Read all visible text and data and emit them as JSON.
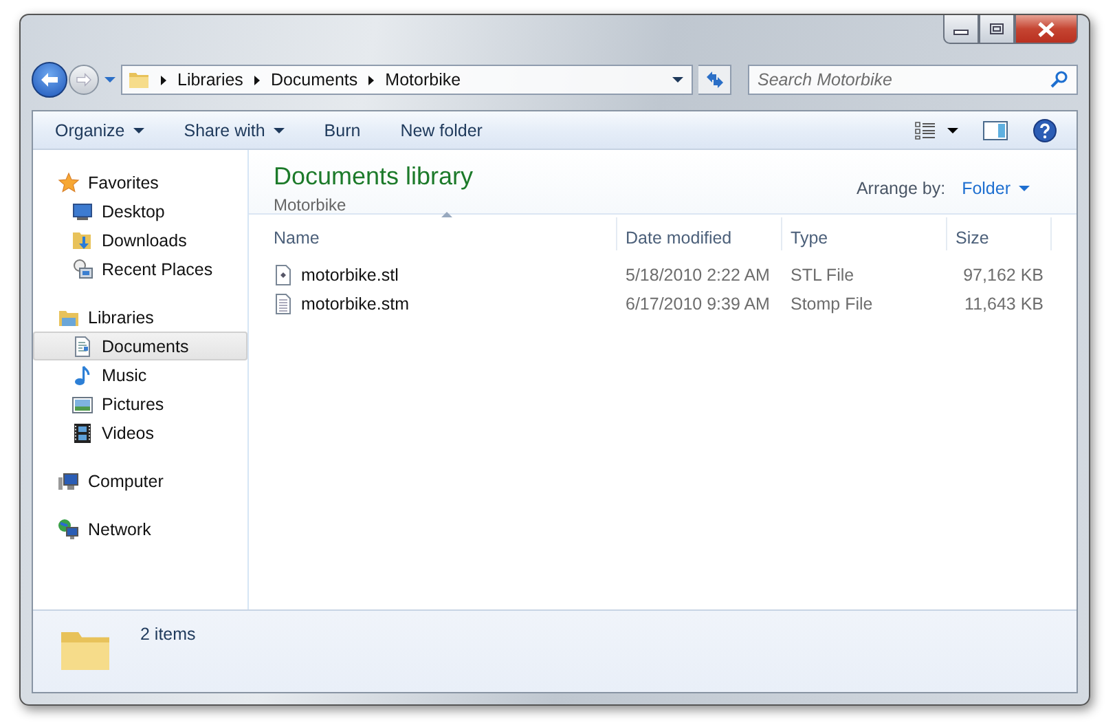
{
  "window": {
    "caption_buttons": [
      {
        "kind": "minimize"
      },
      {
        "kind": "maximize"
      },
      {
        "kind": "close"
      }
    ]
  },
  "address_bar": {
    "crumbs": [
      "Libraries",
      "Documents",
      "Motorbike"
    ]
  },
  "search": {
    "placeholder": "Search Motorbike"
  },
  "toolbar": {
    "items": [
      {
        "label": "Organize",
        "dropdown": true
      },
      {
        "label": "Share with",
        "dropdown": true
      },
      {
        "label": "Burn",
        "dropdown": false
      },
      {
        "label": "New folder",
        "dropdown": false
      }
    ]
  },
  "sidebar": {
    "groups": [
      {
        "label": "Favorites",
        "kind": "favorites",
        "children": [
          {
            "label": "Desktop",
            "kind": "desktop",
            "selected": false
          },
          {
            "label": "Downloads",
            "kind": "downloads",
            "selected": false
          },
          {
            "label": "Recent Places",
            "kind": "recent",
            "selected": false
          }
        ]
      },
      {
        "label": "Libraries",
        "kind": "libraries",
        "children": [
          {
            "label": "Documents",
            "kind": "documents",
            "selected": true
          },
          {
            "label": "Music",
            "kind": "music",
            "selected": false
          },
          {
            "label": "Pictures",
            "kind": "pictures",
            "selected": false
          },
          {
            "label": "Videos",
            "kind": "videos",
            "selected": false
          }
        ]
      },
      {
        "label": "Computer",
        "kind": "computer"
      },
      {
        "label": "Network",
        "kind": "network"
      }
    ]
  },
  "library": {
    "title": "Documents library",
    "subtitle": "Motorbike",
    "arrange_label": "Arrange by:",
    "arrange_value": "Folder"
  },
  "table": {
    "columns": [
      {
        "label": "Name",
        "sorted": true
      },
      {
        "label": "Date modified",
        "sorted": false
      },
      {
        "label": "Type",
        "sorted": false
      },
      {
        "label": "Size",
        "sorted": false
      }
    ],
    "rows": [
      {
        "kind": "model",
        "name": "motorbike.stl",
        "date": "5/18/2010 2:22 AM",
        "type": "STL File",
        "size": "97,162 KB"
      },
      {
        "kind": "text",
        "name": "motorbike.stm",
        "date": "6/17/2010 9:39 AM",
        "type": "Stomp File",
        "size": "11,643 KB"
      }
    ]
  },
  "status_bar": {
    "text": "2 items"
  }
}
